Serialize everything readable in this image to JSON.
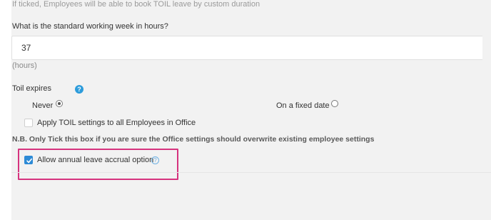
{
  "toil": {
    "custom_duration_hint": "If ticked, Employees will be able to book TOIL leave by custom duration",
    "working_week": {
      "label": "What is the standard working week in hours?",
      "value": "37",
      "unit": "(hours)"
    },
    "expires": {
      "label": "Toil expires",
      "options": [
        {
          "label": "Never",
          "selected": true
        },
        {
          "label": "On a fixed date",
          "selected": false
        }
      ]
    },
    "apply_all": {
      "label": "Apply TOIL settings to all Employees in Office",
      "checked": false
    },
    "nb_note": "N.B. Only Tick this box if you are sure the Office settings should overwrite existing employee settings"
  },
  "accrual": {
    "label": "Allow annual leave accrual option",
    "checked": true
  },
  "icons": {
    "help": "question-circle-icon",
    "check": "checkmark-icon"
  },
  "colors": {
    "accent": "#2d8bd6",
    "highlight": "#d6337e",
    "panel": "#f2f2f2"
  }
}
